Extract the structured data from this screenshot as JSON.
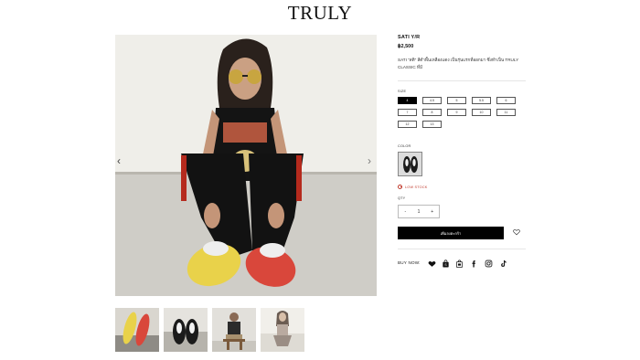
{
  "brand": {
    "logo": "TRULY"
  },
  "product": {
    "name": "SATI Y/R",
    "price": "฿2,500",
    "description": "SATI \"สติ\" สีดำพื้นเหลืองแดง เป็นรุ่นแรกที่ออกมา ซึ่งทำเป็น TRULY CLASSIC ที่มี"
  },
  "size": {
    "label": "SIZE",
    "options": [
      "4",
      "4.5",
      "5",
      "5.5",
      "6",
      "7",
      "8",
      "9",
      "10",
      "11",
      "12",
      "13"
    ],
    "selected": "4"
  },
  "color": {
    "label": "COLOR",
    "selected": "black-white sneaker"
  },
  "stock": {
    "status": "LOW STOCK"
  },
  "quantity": {
    "label": "QTY",
    "minus": "-",
    "value": "1",
    "plus": "+"
  },
  "cart": {
    "button_label": "เพิ่มลงตะกร้า"
  },
  "buy_now": {
    "label": "BUY NOW:",
    "icons": [
      "lazada-icon",
      "shopee-icon",
      "store-bag-icon",
      "facebook-icon",
      "instagram-icon",
      "tiktok-icon"
    ]
  },
  "gallery": {
    "navigation": {
      "prev": "‹",
      "next": "›"
    },
    "thumbnails": [
      "yellow-red-soles",
      "shoes-pair-top",
      "model-sitting-bench",
      "model-sitting-floor"
    ]
  }
}
